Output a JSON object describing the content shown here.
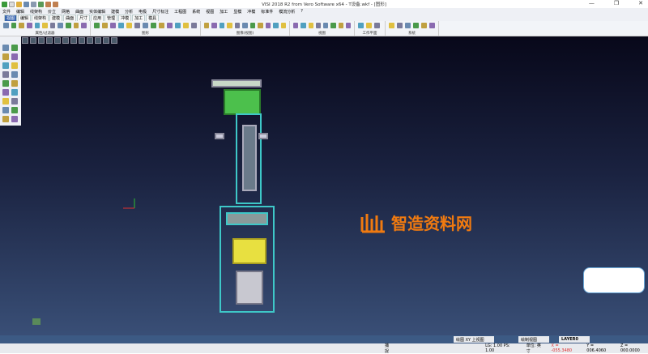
{
  "window": {
    "title": "VISI 2018 R2 from Vero Software x64 - T设备.wkf - [图形]",
    "minimize": "—",
    "maximize": "❐",
    "close": "✕"
  },
  "menu": [
    "文件",
    "编辑",
    "线架构",
    "价立",
    "网格",
    "曲面",
    "实体编辑",
    "建模",
    "分析",
    "电极",
    "尺寸标注",
    "工程图",
    "系统",
    "视图",
    "加工",
    "显模",
    "冲模",
    "标准件",
    "模流分析",
    "?"
  ],
  "tabs": [
    {
      "label": "视图",
      "active": true
    },
    {
      "label": "编辑"
    },
    {
      "label": "线架构"
    },
    {
      "label": "建模"
    },
    {
      "label": "曲面"
    },
    {
      "label": "尺寸"
    },
    {
      "label": "应用"
    },
    {
      "label": "管理"
    },
    {
      "label": "冲模"
    },
    {
      "label": "加工"
    },
    {
      "label": "模具"
    }
  ],
  "ribbon_groups": [
    "属性/过滤器",
    "图形",
    "图像(视图)",
    "视图",
    "工作平面",
    "系统"
  ],
  "watermark": {
    "text": "智造资料网",
    "color": "#f07a10"
  },
  "status": {
    "view_label": "绘图 XY 上视图",
    "draw_view": "绘制视图",
    "layer": "LAYER0",
    "snap": "捕捉",
    "scale": "LG: 1.00 PS: 1.00",
    "units": "单位: 英寸",
    "coord_x": "X = -055.3480",
    "coord_y": "Y = 006.4060",
    "coord_z": "Z = 000.0000"
  }
}
